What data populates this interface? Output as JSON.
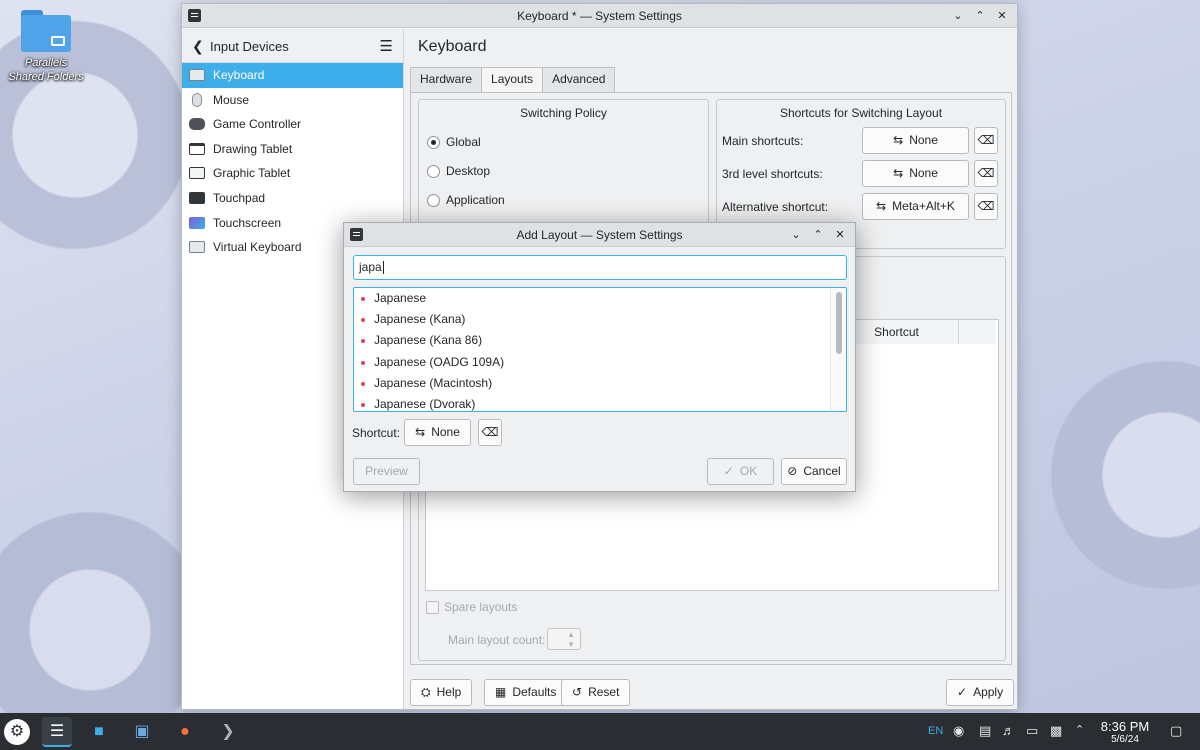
{
  "desktop": {
    "folder_label": "Parallels Shared Folders"
  },
  "window": {
    "title": "Keyboard * — System Settings",
    "sidebar": {
      "header": "Input Devices",
      "items": [
        {
          "label": "Keyboard",
          "icon": "keyboard-icon",
          "active": true
        },
        {
          "label": "Mouse",
          "icon": "mouse-icon"
        },
        {
          "label": "Game Controller",
          "icon": "gamepad-icon"
        },
        {
          "label": "Drawing Tablet",
          "icon": "tablet-icon"
        },
        {
          "label": "Graphic Tablet",
          "icon": "graphic-tablet-icon"
        },
        {
          "label": "Touchpad",
          "icon": "touchpad-icon"
        },
        {
          "label": "Touchscreen",
          "icon": "touchscreen-icon"
        },
        {
          "label": "Virtual Keyboard",
          "icon": "virtual-keyboard-icon"
        }
      ]
    },
    "page_title": "Keyboard",
    "tabs": [
      "Hardware",
      "Layouts",
      "Advanced"
    ],
    "active_tab": "Layouts",
    "switching_policy": {
      "title": "Switching Policy",
      "options": [
        "Global",
        "Desktop",
        "Application"
      ],
      "selected": "Global"
    },
    "shortcuts": {
      "title": "Shortcuts for Switching Layout",
      "rows": [
        {
          "label": "Main shortcuts:",
          "value": "None"
        },
        {
          "label": "3rd level shortcuts:",
          "value": "None"
        },
        {
          "label": "Alternative shortcut:",
          "value": "Meta+Alt+K"
        }
      ]
    },
    "layouts_table": {
      "shortcut_header": "Shortcut"
    },
    "spare_layouts_label": "Spare layouts",
    "main_layout_count_label": "Main layout count:",
    "footer": {
      "help": "Help",
      "defaults": "Defaults",
      "reset": "Reset",
      "apply": "Apply"
    }
  },
  "dialog": {
    "title": "Add Layout — System Settings",
    "search_value": "japa",
    "results": [
      "Japanese",
      "Japanese (Kana)",
      "Japanese (Kana 86)",
      "Japanese (OADG 109A)",
      "Japanese (Macintosh)",
      "Japanese (Dvorak)"
    ],
    "shortcut_label": "Shortcut:",
    "shortcut_value": "None",
    "preview": "Preview",
    "ok": "OK",
    "cancel": "Cancel"
  },
  "taskbar": {
    "keyboard_layout": "EN",
    "time": "8:36 PM",
    "date": "5/6/24"
  },
  "colors": {
    "accent": "#3daee9",
    "taskbar": "#2a2e32",
    "window_bg": "#eff0f1"
  }
}
